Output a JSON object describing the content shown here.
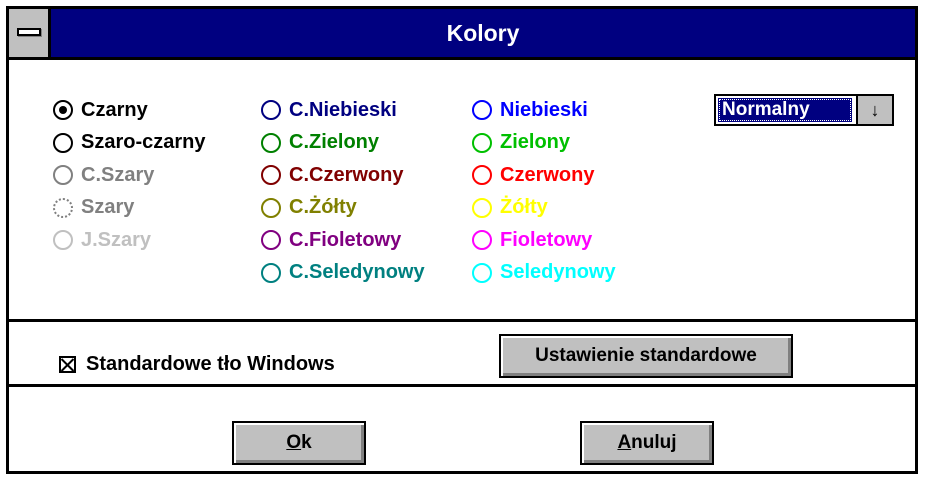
{
  "window": {
    "title": "Kolory"
  },
  "colors_group": {
    "options": [
      {
        "label": "Czarny",
        "color": "#000000",
        "checked": true
      },
      {
        "label": "Szaro-czarny",
        "color": "#000000",
        "checked": false
      },
      {
        "label": "C.Szary",
        "color": "#808080",
        "checked": false
      },
      {
        "label": "Szary",
        "color": "#808080",
        "checked": false
      },
      {
        "label": "J.Szary",
        "color": "#c0c0c0",
        "checked": false
      },
      {
        "label": "C.Niebieski",
        "color": "#000080",
        "checked": false
      },
      {
        "label": "C.Zielony",
        "color": "#008000",
        "checked": false
      },
      {
        "label": "C.Czerwony",
        "color": "#800000",
        "checked": false
      },
      {
        "label": "C.Żółty",
        "color": "#808000",
        "checked": false
      },
      {
        "label": "C.Fioletowy",
        "color": "#800080",
        "checked": false
      },
      {
        "label": "C.Seledynowy",
        "color": "#008080",
        "checked": false
      },
      {
        "label": "Niebieski",
        "color": "#0000ff",
        "checked": false
      },
      {
        "label": "Zielony",
        "color": "#00c000",
        "checked": false
      },
      {
        "label": "Czerwony",
        "color": "#ff0000",
        "checked": false
      },
      {
        "label": "Żółty",
        "color": "#ffff00",
        "checked": false
      },
      {
        "label": "Fioletowy",
        "color": "#ff00ff",
        "checked": false
      },
      {
        "label": "Seledynowy",
        "color": "#00ffff",
        "checked": false
      }
    ]
  },
  "mode_select": {
    "value": "Normalny",
    "arrow": "↓"
  },
  "standard_bg": {
    "label": "Standardowe tło Windows",
    "checked": true
  },
  "buttons": {
    "reset_label": "Ustawienie standardowe",
    "ok_underline": "O",
    "ok_rest": "k",
    "cancel_underline": "A",
    "cancel_rest": "nuluj"
  }
}
